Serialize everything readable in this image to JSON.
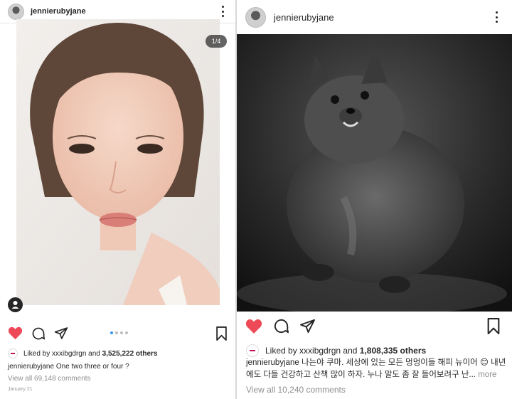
{
  "left_post": {
    "username": "jennierubyjane",
    "photo_counter": "1/4",
    "liked_by_prefix": "Liked by",
    "liked_by_user": "xxxibgdrgn",
    "liked_by_and": "and",
    "liked_by_count": "3,525,222 others",
    "caption_user": "jennierubyjane",
    "caption_text": "One two three or four ?",
    "view_comments": "View all 69,148 comments",
    "date": "January 21",
    "carousel_dots": 4,
    "carousel_active_index": 0
  },
  "right_post": {
    "username": "jennierubyjane",
    "liked_by_prefix": "Liked by",
    "liked_by_user": "xxxibgdrgn",
    "liked_by_and": "and",
    "liked_by_count": "1,808,335 others",
    "caption_user": "jennierubyjane",
    "caption_text": "나는야 쿠마. 세상에 있는 모든 멍멍이들 해피 뉴이어 😊 내년에도 다들 건강하고 산책 많이 하자. 누나 말도 좀 잘 들어보려구 난...",
    "more_label": "more",
    "view_comments": "View all 10,240 comments"
  },
  "icons": {
    "heart": "heart-icon",
    "comment": "comment-icon",
    "share": "share-icon",
    "bookmark": "bookmark-icon",
    "more": "more-vertical-icon",
    "tag": "user-tag-icon"
  },
  "colors": {
    "like_red": "#ed4956",
    "text": "#262626",
    "muted": "#8e8e8e",
    "carousel_active": "#3897f0"
  }
}
